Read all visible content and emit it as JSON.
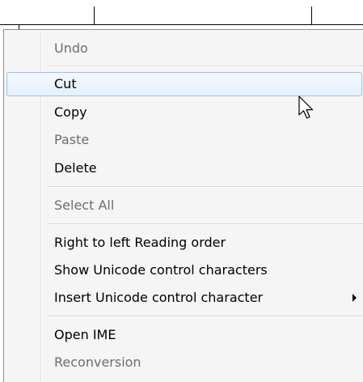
{
  "context_menu": {
    "items": [
      {
        "label": "Undo",
        "enabled": false
      },
      {
        "label": "Cut",
        "enabled": true,
        "hovered": true
      },
      {
        "label": "Copy",
        "enabled": true
      },
      {
        "label": "Paste",
        "enabled": false
      },
      {
        "label": "Delete",
        "enabled": true
      },
      {
        "label": "Select All",
        "enabled": false
      },
      {
        "label": "Right to left Reading order",
        "enabled": true
      },
      {
        "label": "Show Unicode control characters",
        "enabled": true
      },
      {
        "label": "Insert Unicode control character",
        "enabled": true,
        "has_submenu": true,
        "submenu_icon": "chevron-right-icon"
      },
      {
        "label": "Open IME",
        "enabled": true
      },
      {
        "label": "Reconversion",
        "enabled": false
      }
    ]
  },
  "colors": {
    "menu_background": "#f5f5f5",
    "disabled_text": "#6d6d6d",
    "hover_border": "#9bc2ea"
  },
  "icons": {
    "cursor": "mouse-pointer-icon"
  }
}
